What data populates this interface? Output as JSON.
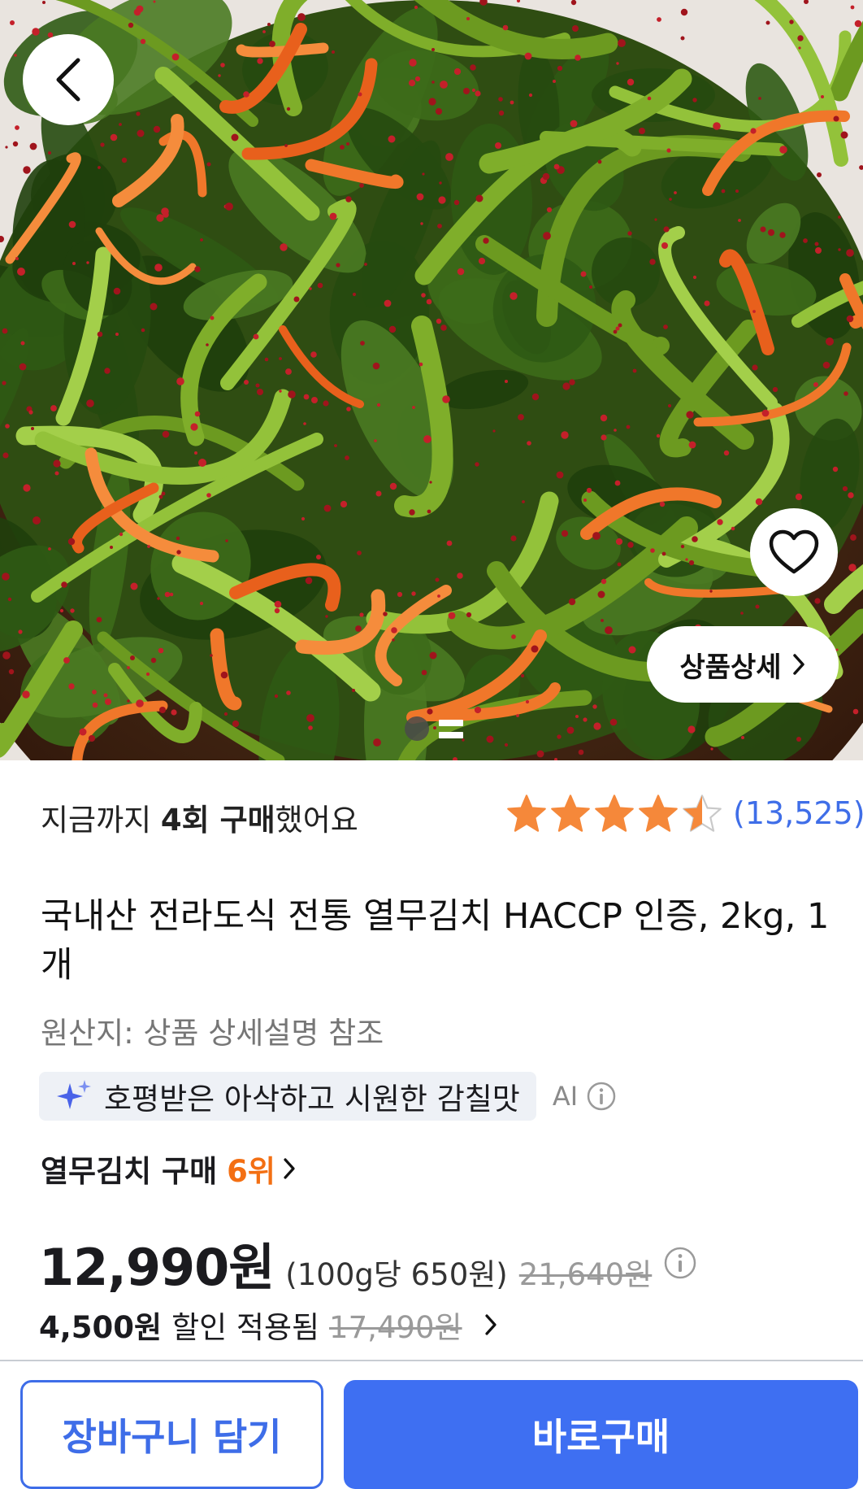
{
  "hero": {
    "image_description_icon": "kimchi-photo",
    "detail_button_label": "상품상세",
    "pagination": {
      "current": 1,
      "total": 2
    }
  },
  "purchase_history": {
    "prefix": "지금까지 ",
    "count": "4회 구매",
    "suffix": "했어요"
  },
  "rating": {
    "stars": 4.5,
    "review_count": "(13,525)"
  },
  "product": {
    "title": "국내산 전라도식 전통 열무김치 HACCP 인증, 2kg, 1개",
    "origin": "원산지: 상품 상세설명 참조"
  },
  "ai_summary": {
    "text": "호평받은 아삭하고 시원한 감칠맛",
    "label": "AI"
  },
  "rank": {
    "category": "열무김치 구매",
    "position": "6위"
  },
  "price": {
    "sale": "12,990원",
    "unit": "(100g당 650원)",
    "original": "21,640원"
  },
  "discount": {
    "amount": "4,500원",
    "applied_label": "할인 적용됨",
    "before_price": "17,490원"
  },
  "actions": {
    "cart_label": "장바구니 담기",
    "buy_label": "바로구매"
  },
  "colors": {
    "accent_blue": "#3e6ff2",
    "star_orange": "#f5883a",
    "rank_orange": "#f36f13"
  }
}
